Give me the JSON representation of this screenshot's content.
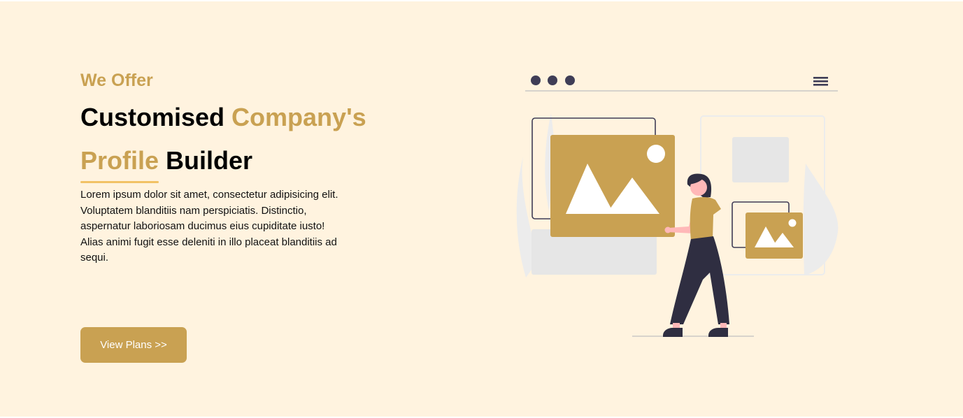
{
  "hero": {
    "eyebrow": "We Offer",
    "headline": {
      "part1": "Customised ",
      "part2": "Company's",
      "part3": "Profile",
      "part4": " Builder"
    },
    "description": "Lorem ipsum dolor sit amet, consectetur adipisicing elit. Voluptatem blanditiis nam perspiciatis. Distinctio, aspernatur laboriosam ducimus eius cupiditate iusto! Alias animi fugit esse deleniti in illo placeat blanditiis ad sequi.",
    "cta_label": "View Plans >>"
  },
  "colors": {
    "background": "#fff3df",
    "accent": "#c9a152",
    "underline": "#f2c265",
    "illustration_dark": "#2f2e41",
    "illustration_light": "#e6e6e6"
  },
  "illustration": {
    "icons": [
      "window-dots-icon",
      "hamburger-menu-icon",
      "image-placeholder-icon",
      "person-figure"
    ]
  }
}
